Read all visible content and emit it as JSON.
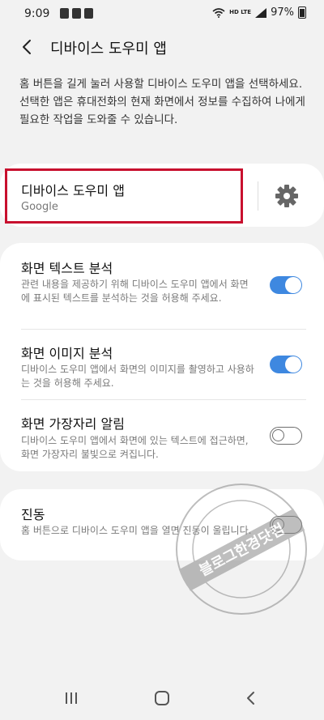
{
  "status_bar": {
    "time": "9:09",
    "network_label": "HD LTE",
    "battery_percent": "97%"
  },
  "header": {
    "title": "디바이스 도우미 앱",
    "back_icon": "chevron-left-icon"
  },
  "description": "홈 버튼을 길게 눌러 사용할 디바이스 도우미 앱을 선택하세요. 선택한 앱은 휴대전화의 현재 화면에서 정보를 수집하여 나에게 필요한 작업을 도와줄 수 있습니다.",
  "assistant": {
    "title": "디바이스 도우미 앱",
    "selected_app": "Google",
    "settings_icon": "gear-icon",
    "highlight_color": "#c8102e"
  },
  "settings": [
    {
      "title": "화면 텍스트 분석",
      "desc": "관련 내용을 제공하기 위해 디바이스 도우미 앱에서 화면에 표시된 텍스트를 분석하는 것을 허용해 주세요.",
      "enabled": true
    },
    {
      "title": "화면 이미지 분석",
      "desc": "디바이스 도우미 앱에서 화면의 이미지를 촬영하고 사용하는 것을 허용해 주세요.",
      "enabled": true
    },
    {
      "title": "화면 가장자리 알림",
      "desc": "디바이스 도우미 앱에서 화면에 있는 텍스트에 접근하면, 화면 가장자리 불빛으로 켜집니다.",
      "enabled": false
    }
  ],
  "vibration": {
    "title": "진동",
    "desc": "홈 버튼으로 디바이스 도우미 앱을 열면 진동이 울립니다.",
    "enabled": false
  },
  "watermark": {
    "text": "블로그한경닷컴"
  },
  "colors": {
    "accent": "#3e88e0",
    "background": "#f2f2f2",
    "card": "#ffffff",
    "highlight": "#c8102e"
  },
  "navbar": {
    "recents_icon": "recents-icon",
    "home_icon": "home-icon",
    "back_icon": "back-icon"
  }
}
